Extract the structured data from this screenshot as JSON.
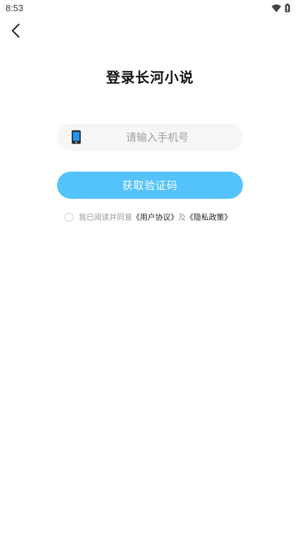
{
  "status_bar": {
    "time": "8:53",
    "icons": [
      "wifi-icon",
      "battery-icon"
    ]
  },
  "nav": {
    "back_icon": "chevron-left-icon"
  },
  "title": "登录长河小说",
  "phone_field": {
    "placeholder": "请输入手机号",
    "value": "",
    "icon": "mobile-phone-icon"
  },
  "get_code_button": {
    "label": "获取验证码"
  },
  "agreement": {
    "checked": false,
    "prefix": "我已阅读并同意",
    "user_agreement": "《用户协议》",
    "conjunction": "及",
    "privacy_policy": "《隐私政策》"
  },
  "colors": {
    "accent": "#55c3fb",
    "field_background": "#f6f6f6",
    "phone_icon_blue": "#2196f3"
  }
}
